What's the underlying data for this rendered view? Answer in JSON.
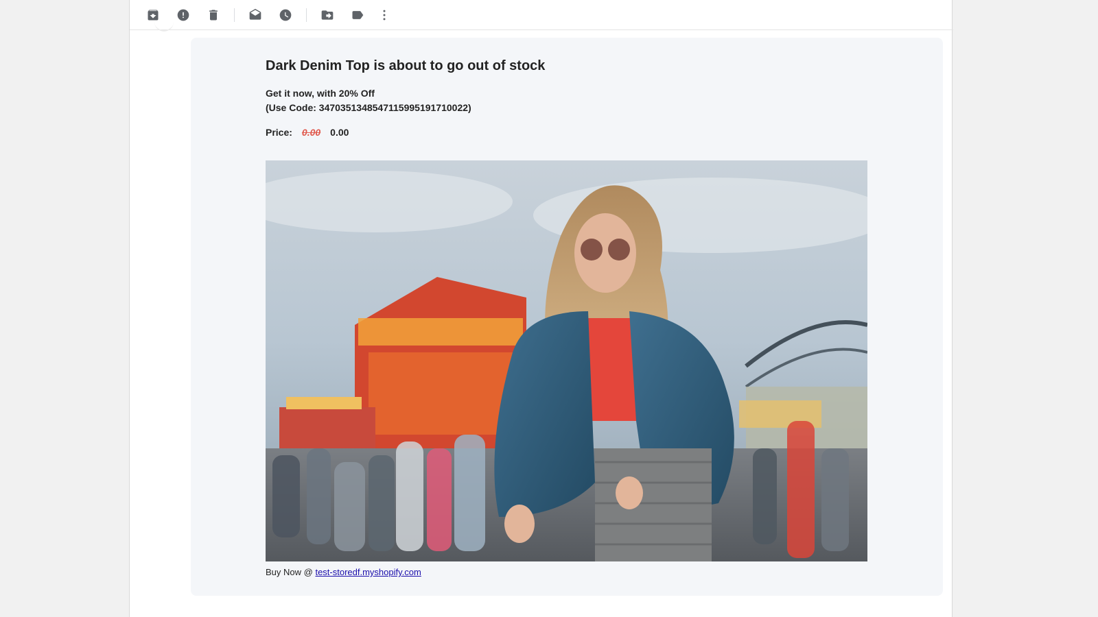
{
  "toolbar": {
    "items": [
      {
        "name": "archive-icon"
      },
      {
        "name": "report-spam-icon"
      },
      {
        "name": "delete-icon"
      },
      {
        "name": "mark-unread-icon"
      },
      {
        "name": "snooze-icon"
      },
      {
        "name": "move-to-icon"
      },
      {
        "name": "label-icon"
      },
      {
        "name": "more-options-icon"
      }
    ]
  },
  "email": {
    "headline": "Dark Denim Top is about to go out of stock",
    "offer_line": "Get it now, with 20% Off",
    "code_line": "(Use Code: 3470351348547115995191710022)",
    "price_label": "Price:",
    "old_price": "0.00",
    "new_price": "0.00",
    "buy_prefix": "Buy Now @",
    "store_link": "test-storedf.myshopify.com"
  },
  "colors": {
    "old_price": "#e05a4e",
    "link": "#1a0dab",
    "card_bg": "#f4f6f9"
  }
}
